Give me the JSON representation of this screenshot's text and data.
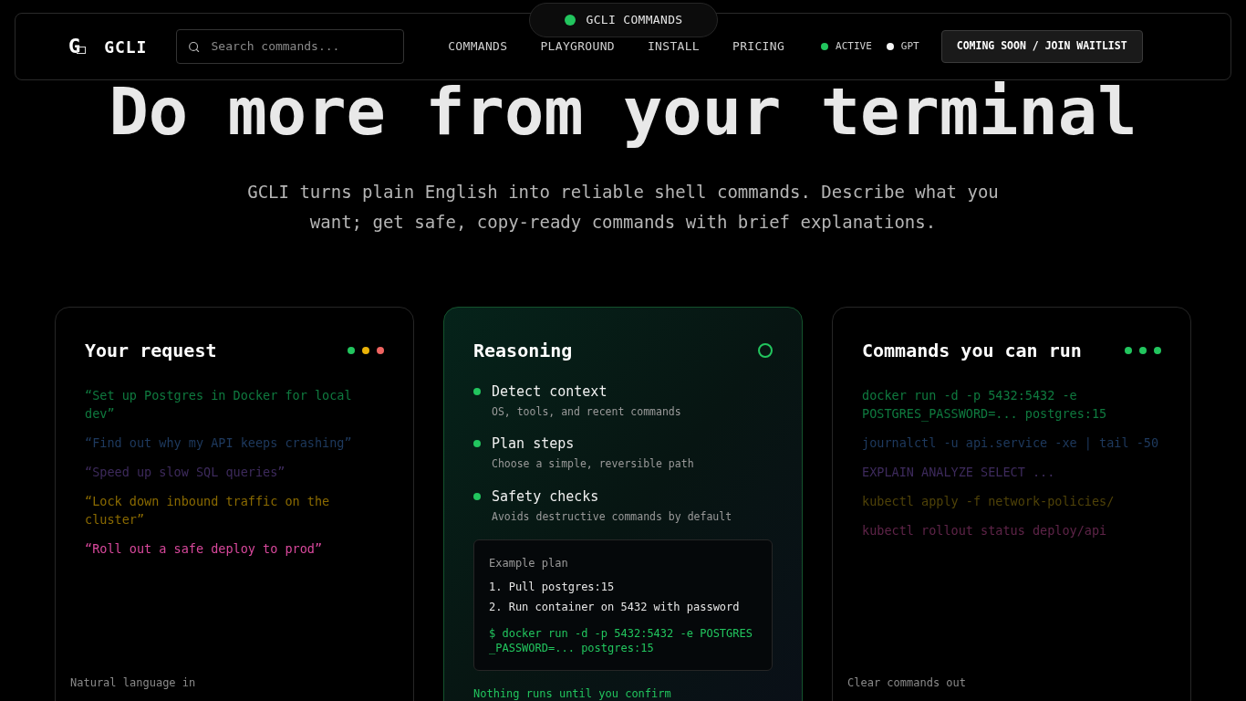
{
  "badge": {
    "label": "GCLI COMMANDS",
    "color": "#22c55e"
  },
  "nav": {
    "logo_letter": "G",
    "brand": "GCLI",
    "search": {
      "placeholder": "Search commands..."
    },
    "links": [
      "COMMANDS",
      "PLAYGROUND",
      "INSTALL",
      "PRICING"
    ],
    "statuses": [
      {
        "label": "ACTIVE",
        "color": "#22c55e"
      },
      {
        "label": "GPT",
        "color": "#f5f5f5"
      }
    ],
    "cta": "COMING SOON / JOIN WAITLIST"
  },
  "hero": {
    "title": "Do more from your terminal",
    "subtitle": "GCLI turns plain English into reliable shell commands. Describe what you want; get safe, copy-ready commands with brief explanations."
  },
  "cards": [
    {
      "kind": "list",
      "title": "Your request",
      "dots": [
        {
          "color": "#22c55e"
        },
        {
          "color": "#eab308"
        },
        {
          "color": "#ef6461"
        }
      ],
      "items": [
        {
          "text": "“Set up Postgres in Docker for local dev”",
          "color": "#0f7a3f"
        },
        {
          "text": "“Find out why my API keeps crashing”",
          "color": "#1e3a5f"
        },
        {
          "text": "“Speed up slow SQL queries”",
          "color": "#3d2a5c"
        },
        {
          "text": "“Lock down inbound traffic on the cluster”",
          "color": "#8a6a00"
        },
        {
          "text": "“Roll out a safe deploy to prod”",
          "color": "#d9489c"
        }
      ],
      "footer": "Natural language in"
    },
    {
      "kind": "reasoning",
      "title": "Reasoning",
      "steps": [
        {
          "title": "Detect context",
          "detail": "OS, tools, and recent commands"
        },
        {
          "title": "Plan steps",
          "detail": "Choose a simple, reversible path"
        },
        {
          "title": "Safety checks",
          "detail": "Avoids destructive commands by default"
        }
      ],
      "example": {
        "title": "Example plan",
        "steps": [
          "1. Pull postgres:15",
          "2. Run container on 5432 with password"
        ],
        "command": "$ docker run -d -p 5432:5432 -e POSTGRES _PASSWORD=... postgres:15"
      },
      "footer": "Nothing runs until you confirm"
    },
    {
      "kind": "list",
      "title": "Commands you can run",
      "dots": [
        {
          "color": "#22c55e"
        },
        {
          "color": "#22c55e"
        },
        {
          "color": "#22c55e"
        }
      ],
      "items": [
        {
          "text": "docker run -d -p 5432:5432 -e POSTGRES_PASSWORD=... postgres:15",
          "color": "#0f7a3f"
        },
        {
          "text": "journalctl -u api.service -xe | tail -50",
          "color": "#1e3a5f"
        },
        {
          "text": "EXPLAIN ANALYZE SELECT ...",
          "color": "#3d2a5c"
        },
        {
          "text": "kubectl apply -f network-policies/",
          "color": "#4f4208"
        },
        {
          "text": "kubectl rollout status deploy/api",
          "color": "#5e2448"
        }
      ],
      "footer": "Clear commands out"
    }
  ]
}
